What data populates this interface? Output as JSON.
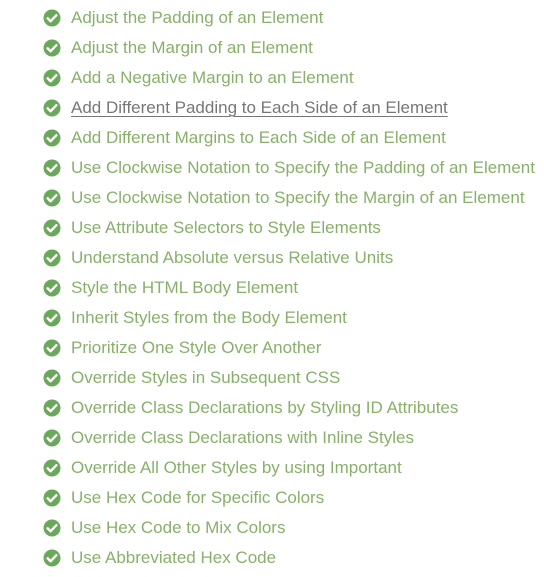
{
  "colors": {
    "completed_text": "#88b06a",
    "check_fill": "#6ca85c",
    "hovered_text": "#777777"
  },
  "icon": "check-circle-icon",
  "lessons": [
    {
      "label": "Adjust the Padding of an Element",
      "completed": true,
      "hovered": false
    },
    {
      "label": "Adjust the Margin of an Element",
      "completed": true,
      "hovered": false
    },
    {
      "label": "Add a Negative Margin to an Element",
      "completed": true,
      "hovered": false
    },
    {
      "label": "Add Different Padding to Each Side of an Element",
      "completed": true,
      "hovered": true
    },
    {
      "label": "Add Different Margins to Each Side of an Element",
      "completed": true,
      "hovered": false
    },
    {
      "label": "Use Clockwise Notation to Specify the Padding of an Element",
      "completed": true,
      "hovered": false
    },
    {
      "label": "Use Clockwise Notation to Specify the Margin of an Element",
      "completed": true,
      "hovered": false
    },
    {
      "label": "Use Attribute Selectors to Style Elements",
      "completed": true,
      "hovered": false
    },
    {
      "label": "Understand Absolute versus Relative Units",
      "completed": true,
      "hovered": false
    },
    {
      "label": "Style the HTML Body Element",
      "completed": true,
      "hovered": false
    },
    {
      "label": "Inherit Styles from the Body Element",
      "completed": true,
      "hovered": false
    },
    {
      "label": "Prioritize One Style Over Another",
      "completed": true,
      "hovered": false
    },
    {
      "label": "Override Styles in Subsequent CSS",
      "completed": true,
      "hovered": false
    },
    {
      "label": "Override Class Declarations by Styling ID Attributes",
      "completed": true,
      "hovered": false
    },
    {
      "label": "Override Class Declarations with Inline Styles",
      "completed": true,
      "hovered": false
    },
    {
      "label": "Override All Other Styles by using Important",
      "completed": true,
      "hovered": false
    },
    {
      "label": "Use Hex Code for Specific Colors",
      "completed": true,
      "hovered": false
    },
    {
      "label": "Use Hex Code to Mix Colors",
      "completed": true,
      "hovered": false
    },
    {
      "label": "Use Abbreviated Hex Code",
      "completed": true,
      "hovered": false
    }
  ]
}
